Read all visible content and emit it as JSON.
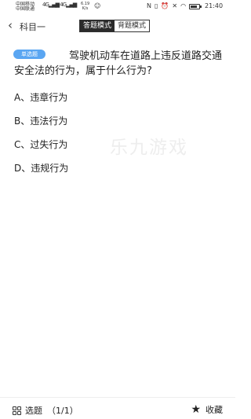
{
  "status_bar": {
    "carrier1": "中国移动",
    "carrier2": "中国联通",
    "net_type1": "4G",
    "net_type2": "4G",
    "speed_value": "6.19",
    "speed_unit": "K/s",
    "time": "21:40",
    "battery_level": 0.8
  },
  "nav": {
    "back_icon": "chevron-left-icon",
    "title": "科目一",
    "mode_answer": "答题模式",
    "mode_recite": "背题模式"
  },
  "question": {
    "type_badge": "单选题",
    "text": "驾驶机动车在道路上违反道路交通安全法的行为，属于什么行为?",
    "options": [
      "A、违章行为",
      "B、违法行为",
      "C、过失行为",
      "D、违规行为"
    ]
  },
  "watermark": "乐九游戏",
  "bottom_bar": {
    "question_list_label": "选题",
    "question_count": "（1/1）",
    "favorite_label": "收藏"
  }
}
